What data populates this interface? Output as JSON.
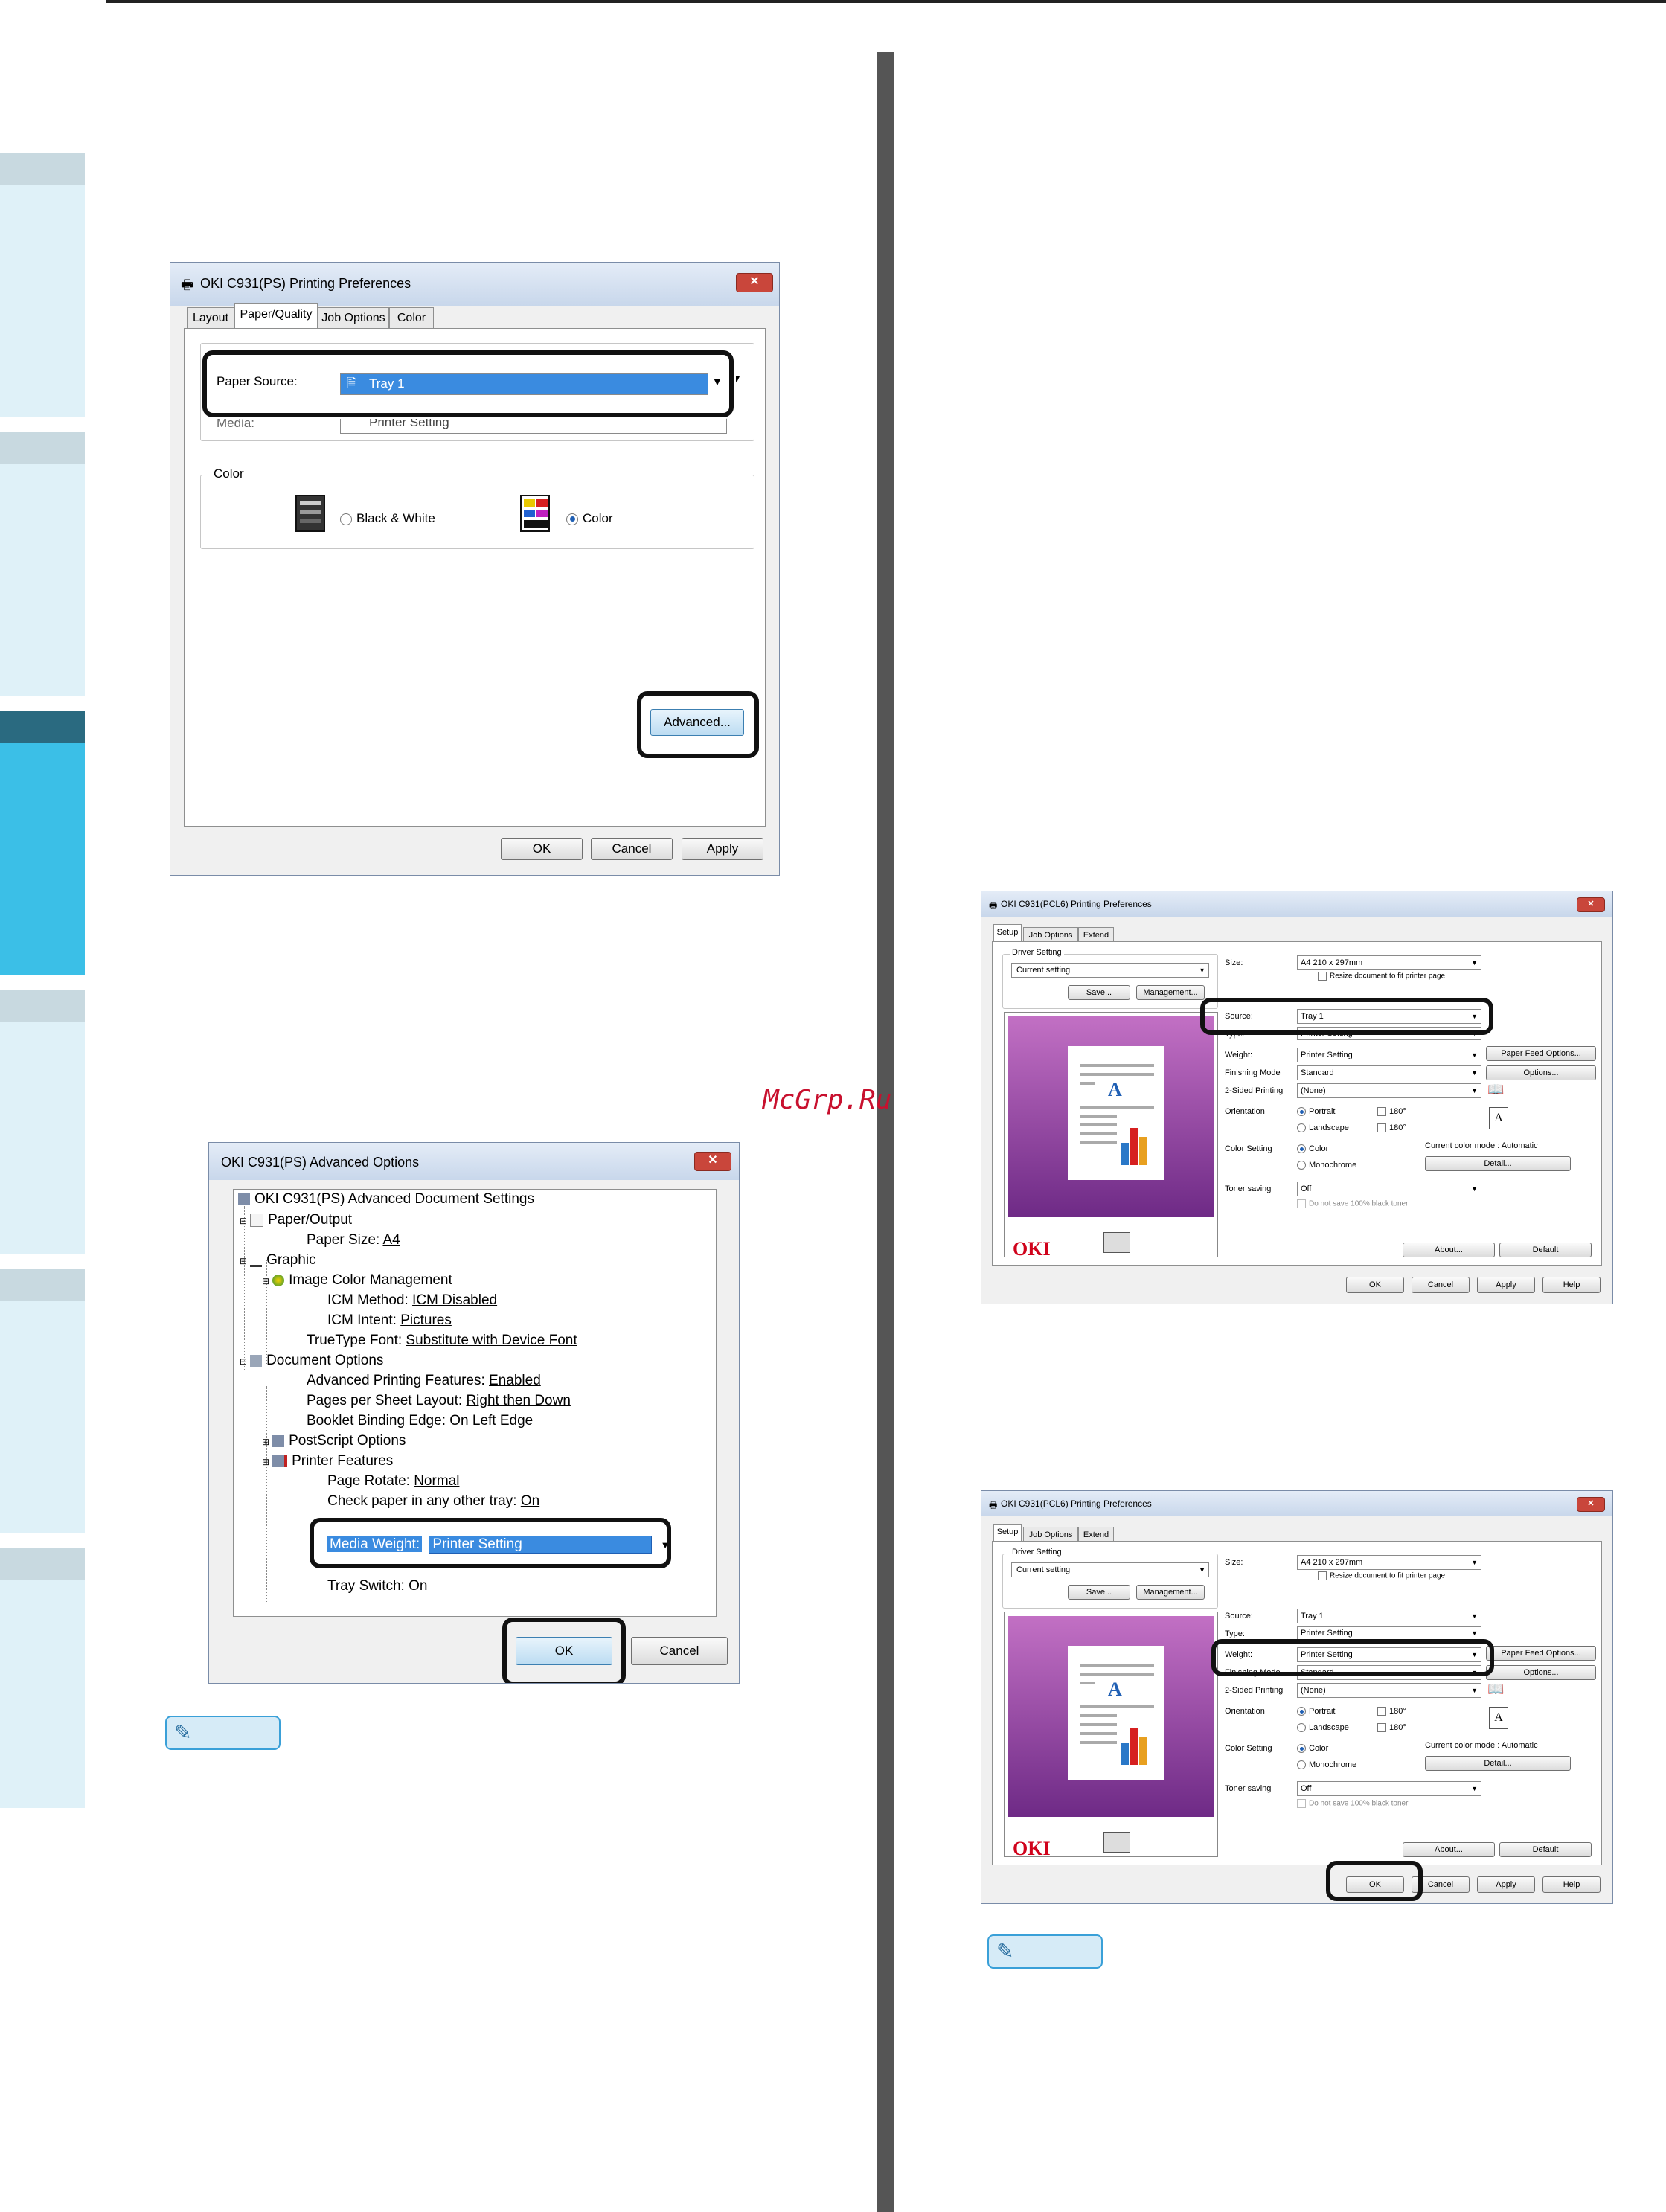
{
  "watermark": "McGrp.Ru",
  "memo_icon": "pencil-icon",
  "dialog1": {
    "title": "OKI C931(PS) Printing Preferences",
    "tabs": [
      "Layout",
      "Paper/Quality",
      "Job Options",
      "Color"
    ],
    "paper_source_label": "Paper Source:",
    "paper_source_value": "Tray 1",
    "media_label": "Media:",
    "media_value": "Printer Setting",
    "color_group": "Color",
    "bw_label": "Black & White",
    "color_label": "Color",
    "advanced_button": "Advanced...",
    "ok": "OK",
    "cancel": "Cancel",
    "apply": "Apply"
  },
  "dialog2": {
    "title": "OKI C931(PS) Advanced Options",
    "tree": {
      "root": "OKI C931(PS) Advanced Document Settings",
      "paper_output": "Paper/Output",
      "paper_size_label": "Paper Size: ",
      "paper_size_value": "A4",
      "graphic": "Graphic",
      "icm": "Image Color Management",
      "icm_method_label": "ICM Method: ",
      "icm_method_value": "ICM Disabled",
      "icm_intent_label": "ICM Intent: ",
      "icm_intent_value": "Pictures",
      "truetype_label": "TrueType Font: ",
      "truetype_value": "Substitute with Device Font",
      "document_options": "Document Options",
      "adv_print_label": "Advanced Printing Features: ",
      "adv_print_value": "Enabled",
      "pps_label": "Pages per Sheet Layout: ",
      "pps_value": "Right then Down",
      "booklet_label": "Booklet Binding Edge: ",
      "booklet_value": "On Left Edge",
      "postscript": "PostScript Options",
      "printer_features": "Printer Features",
      "rotate_label": "Page Rotate: ",
      "rotate_value": "Normal",
      "check_label": "Check paper in any other tray: ",
      "check_value": "On",
      "media_weight_label": "Media Weight:",
      "media_weight_value": "Printer Setting",
      "tray_switch_label": "Tray Switch: ",
      "tray_switch_value": "On"
    },
    "ok": "OK",
    "cancel": "Cancel"
  },
  "pcl_dialogs": [
    {
      "title": "OKI C931(PCL6) Printing Preferences",
      "tabs": [
        "Setup",
        "Job Options",
        "Extend"
      ],
      "driver_setting": "Driver Setting",
      "current_setting": "Current setting",
      "save": "Save...",
      "management": "Management...",
      "size_label": "Size:",
      "size_value": "A4 210 x 297mm",
      "resize": "Resize document to fit printer page",
      "source_label": "Source:",
      "source_value": "Tray 1",
      "type_label": "Type:",
      "type_value": "Printer Setting",
      "weight_label": "Weight:",
      "weight_value": "Printer Setting",
      "paper_feed_options": "Paper Feed Options...",
      "finishing_label": "Finishing Mode",
      "finishing_value": "Standard",
      "options": "Options...",
      "two_sided_label": "2-Sided Printing",
      "two_sided_value": "(None)",
      "orientation_label": "Orientation",
      "portrait": "Portrait",
      "landscape": "Landscape",
      "rot180": "180°",
      "color_setting_label": "Color Setting",
      "color": "Color",
      "monochrome": "Monochrome",
      "current_color_mode": "Current color mode : Automatic",
      "detail": "Detail...",
      "toner_label": "Toner saving",
      "toner_value": "Off",
      "no_black": "Do not save 100% black toner",
      "logo": "OKI",
      "about": "About...",
      "default": "Default",
      "ok": "OK",
      "cancel": "Cancel",
      "apply": "Apply",
      "help": "Help"
    },
    {
      "title": "OKI C931(PCL6) Printing Preferences",
      "tabs": [
        "Setup",
        "Job Options",
        "Extend"
      ],
      "driver_setting": "Driver Setting",
      "current_setting": "Current setting",
      "save": "Save...",
      "management": "Management...",
      "size_label": "Size:",
      "size_value": "A4 210 x 297mm",
      "resize": "Resize document to fit printer page",
      "source_label": "Source:",
      "source_value": "Tray 1",
      "type_label": "Type:",
      "type_value": "Printer Setting",
      "weight_label": "Weight:",
      "weight_value": "Printer Setting",
      "paper_feed_options": "Paper Feed Options...",
      "finishing_label": "Finishing Mode",
      "finishing_value": "Standard",
      "options": "Options...",
      "two_sided_label": "2-Sided Printing",
      "two_sided_value": "(None)",
      "orientation_label": "Orientation",
      "portrait": "Portrait",
      "landscape": "Landscape",
      "rot180": "180°",
      "color_setting_label": "Color Setting",
      "color": "Color",
      "monochrome": "Monochrome",
      "current_color_mode": "Current color mode : Automatic",
      "detail": "Detail...",
      "toner_label": "Toner saving",
      "toner_value": "Off",
      "no_black": "Do not save 100% black toner",
      "logo": "OKI",
      "about": "About...",
      "default": "Default",
      "ok": "OK",
      "cancel": "Cancel",
      "apply": "Apply",
      "help": "Help"
    }
  ]
}
